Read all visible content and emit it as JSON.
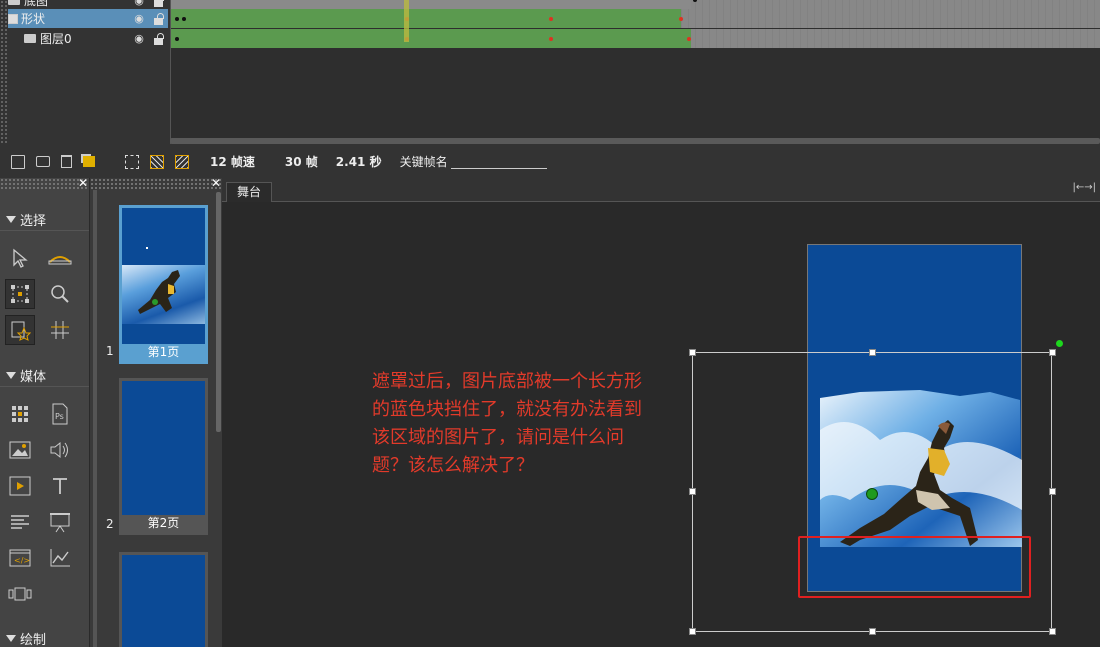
{
  "layers": [
    {
      "name": "底图"
    },
    {
      "name": "形状"
    },
    {
      "name": "图层0"
    }
  ],
  "timeline": {
    "fps_label": "12 帧速",
    "frames_label": "30 帧",
    "duration_label": "2.41 秒",
    "keyframe_name_label": "关键帧名"
  },
  "tools": {
    "section_select": "选择",
    "section_media": "媒体",
    "section_draw": "绘制"
  },
  "pages": [
    {
      "number": "1",
      "label": "第1页"
    },
    {
      "number": "2",
      "label": "第2页"
    }
  ],
  "stage": {
    "tab_label": "舞台",
    "note_text": "遮罩过后，图片底部被一个长方形的蓝色块挡住了，就没有办法看到该区域的图片了，请问是什么问题？该怎么解决了？"
  },
  "colors": {
    "page_blue": "#0b4a96",
    "tween_green": "#5b9a4f",
    "selected_layer": "#5a8fb8",
    "annotation_red": "#e02020"
  }
}
